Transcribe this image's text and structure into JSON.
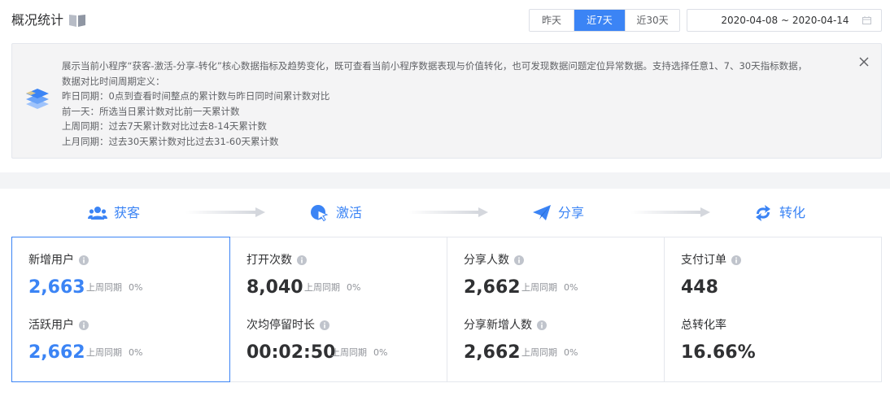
{
  "header": {
    "title": "概况统计",
    "date_range_tabs": [
      {
        "label": "昨天",
        "active": false
      },
      {
        "label": "近7天",
        "active": true
      },
      {
        "label": "近30天",
        "active": false
      }
    ],
    "date_picker": {
      "value": "2020-04-08 ~ 2020-04-14",
      "icon": "calendar-icon"
    }
  },
  "info_box": {
    "icon": "layers-icon",
    "lines": [
      "展示当前小程序“获客-激活-分享-转化”核心数据指标及趋势变化，既可查看当前小程序数据表现与价值转化，也可发现数据问题定位异常数据。支持选择任意1、7、30天指标数据，",
      "数据对比时间周期定义：",
      "昨日同期：0点到查看时间整点的累计数与昨日同时间累计数对比",
      "前一天：所选当日累计数对比前一天累计数",
      "上周同期：过去7天累计数对比过去8-14天累计数",
      "上月同期：过去30天累计数对比过去31-60天累计数"
    ]
  },
  "funnel": {
    "stages": [
      {
        "label": "获客",
        "icon": "users-icon"
      },
      {
        "label": "激活",
        "icon": "cursor-click-icon"
      },
      {
        "label": "分享",
        "icon": "paper-plane-icon"
      },
      {
        "label": "转化",
        "icon": "convert-arrows-icon"
      }
    ]
  },
  "cards": [
    {
      "active": true,
      "metrics": [
        {
          "label": "新增用户",
          "value": "2,663",
          "compare_label": "上周同期",
          "compare_value": "0%"
        },
        {
          "label": "活跃用户",
          "value": "2,662",
          "compare_label": "上周同期",
          "compare_value": "0%"
        }
      ]
    },
    {
      "active": false,
      "metrics": [
        {
          "label": "打开次数",
          "value": "8,040",
          "compare_label": "上周同期",
          "compare_value": "0%"
        },
        {
          "label": "次均停留时长",
          "value": "00:02:50",
          "compare_label": "上周同期",
          "compare_value": "0%"
        }
      ]
    },
    {
      "active": false,
      "metrics": [
        {
          "label": "分享人数",
          "value": "2,662",
          "compare_label": "上周同期",
          "compare_value": "0%"
        },
        {
          "label": "分享新增人数",
          "value": "2,662",
          "compare_label": "上周同期",
          "compare_value": "0%"
        }
      ]
    },
    {
      "active": false,
      "metrics": [
        {
          "label": "支付订单",
          "value": "448"
        },
        {
          "label": "总转化率",
          "value": "16.66%"
        }
      ]
    }
  ],
  "colors": {
    "accent": "#3b84f5",
    "text": "#303133",
    "muted": "#909399"
  }
}
